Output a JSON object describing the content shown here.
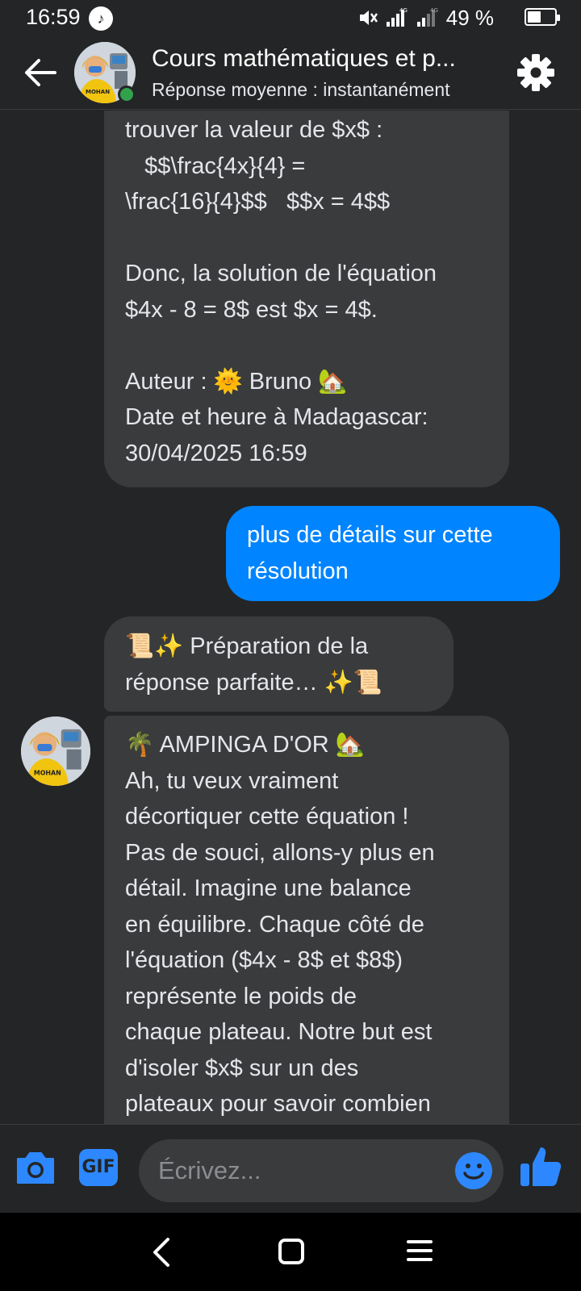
{
  "status_bar": {
    "time": "16:59",
    "network": "4G",
    "battery": "49 %",
    "battery_level": 0.49
  },
  "header": {
    "title": "Cours mathématiques et p...",
    "subtitle": "Réponse moyenne : instantanément",
    "online": true,
    "icons": {
      "back": "back-arrow-icon",
      "settings": "gear-icon"
    }
  },
  "messages": {
    "m1": {
      "lines": [
        "trouver la valeur de $x$ :",
        "   $$\\frac{4x}{4} =",
        "\\frac{16}{4}$$   $$x = 4$$",
        "",
        "Donc, la solution de l'équation",
        "$4x - 8 = 8$ est $x = 4$.",
        "",
        "Auteur : 🌞 Bruno 🏡",
        "Date et heure à Madagascar:",
        "30/04/2025 16:59"
      ]
    },
    "m2": {
      "text": "plus de détails sur cette\nrésolution"
    },
    "m3": {
      "text": "📜✨ Préparation de la\nréponse parfaite… ✨📜"
    },
    "m4": {
      "lines": [
        "🌴 AMPINGA D'OR 🏡",
        "Ah, tu veux vraiment",
        "décortiquer cette équation !",
        "Pas de souci, allons-y plus en",
        "détail. Imagine une balance",
        "en équilibre. Chaque côté de",
        "l'équation ($4x - 8$ et $8$)",
        "représente le poids de",
        "chaque plateau. Notre but est",
        "d'isoler $x$ sur un des",
        "plateaux pour savoir combien"
      ]
    }
  },
  "composer": {
    "placeholder": "Écrivez...",
    "gif_label": "GIF",
    "icons": {
      "camera": "camera-icon",
      "gif": "gif-icon",
      "emoji": "smile-icon",
      "like": "thumbs-up-icon"
    }
  },
  "nav": {
    "icons": [
      "back-icon",
      "home-icon",
      "recents-icon"
    ]
  },
  "colors": {
    "background": "#242526",
    "bubble_incoming": "#3a3b3c",
    "bubble_outgoing": "#0084ff",
    "accent": "#2d88ff",
    "online": "#31a24c"
  }
}
